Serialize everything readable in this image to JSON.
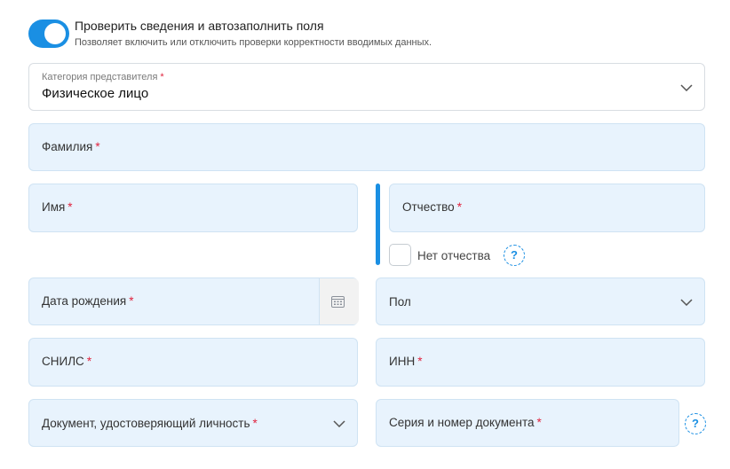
{
  "toggle": {
    "on": true,
    "title": "Проверить сведения и автозаполнить поля",
    "subtitle": "Позволяет включить или отключить проверки корректности вводимых данных."
  },
  "category": {
    "label": "Категория представителя",
    "required_mark": "*",
    "value": "Физическое лицо"
  },
  "fields": {
    "last_name": {
      "label": "Фамилия",
      "required_mark": "*"
    },
    "first_name": {
      "label": "Имя",
      "required_mark": "*"
    },
    "patronymic": {
      "label": "Отчество",
      "required_mark": "*"
    },
    "no_patronymic": {
      "label": "Нет отчества",
      "checked": false,
      "help": "?"
    },
    "birth_date": {
      "label": "Дата рождения",
      "required_mark": "*"
    },
    "gender": {
      "label": "Пол"
    },
    "snils": {
      "label": "СНИЛС",
      "required_mark": "*"
    },
    "inn": {
      "label": "ИНН",
      "required_mark": "*"
    },
    "id_document": {
      "label": "Документ, удостоверяющий личность",
      "required_mark": "*"
    },
    "doc_number": {
      "label": "Серия и номер документа",
      "required_mark": "*",
      "help": "?"
    }
  },
  "colors": {
    "accent": "#1a8fe3",
    "field_bg": "#e8f3fd",
    "required": "#e0243f"
  }
}
